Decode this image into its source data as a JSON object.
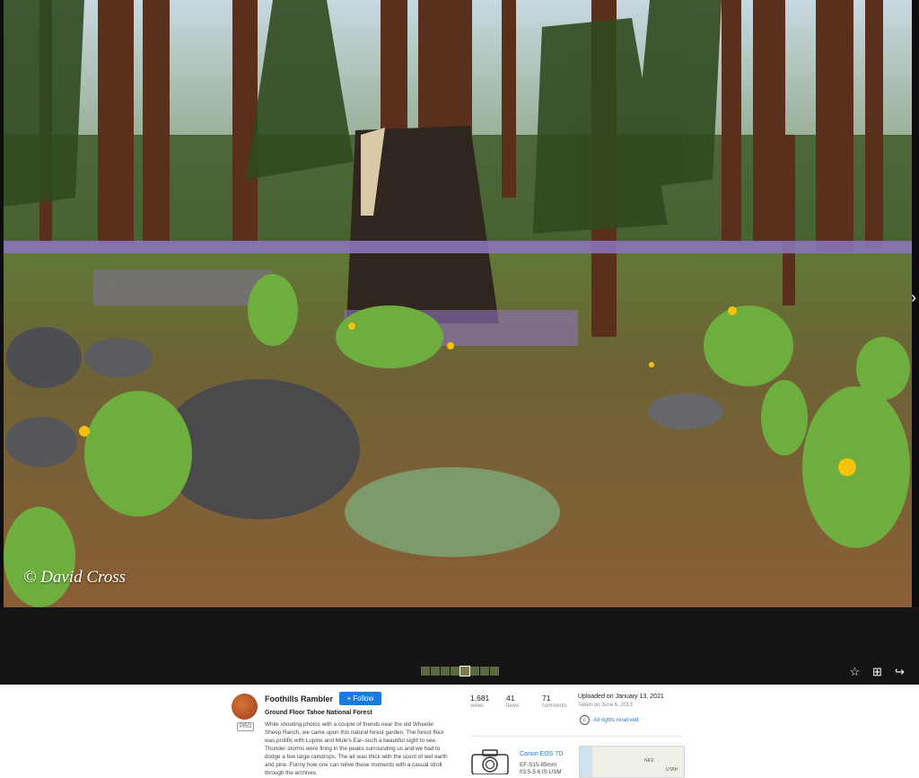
{
  "photo": {
    "watermark": "© David Cross"
  },
  "viewer_actions": {
    "icons": [
      "star-icon",
      "add-to-album-icon",
      "share-icon",
      "download-icon"
    ]
  },
  "author": {
    "name": "Foothills Rambler",
    "badge": "PRO",
    "follow_label": "Follow"
  },
  "photo_info": {
    "title": "Ground Floor Tahoe National Forest",
    "description": "While shooting photos with a couple of friends near the old Wheeler Sheep Ranch, we came upon this natural forest garden. The forest floor was prolific with Lupine and Mule's Ear–such a beautiful sight to see. Thunder storms were firing in the peaks surrounding us and we had to dodge a few large raindrops. The air was thick with the scent of wet earth and pine. Funny how one can relive these moments with a casual stroll through the archives."
  },
  "stats": [
    {
      "value": "1,681",
      "label": "views"
    },
    {
      "value": "41",
      "label": "faves"
    },
    {
      "value": "71",
      "label": "comments"
    }
  ],
  "upload": {
    "uploaded": "Uploaded on January 13, 2021",
    "taken": "Taken on June 6, 2013",
    "rights": "All rights reserved"
  },
  "camera": {
    "model": "Canon EOS 7D",
    "lens": "EF-S15-85mm",
    "aperture": "f/3.5-5.6 IS USM"
  },
  "map": {
    "label_nev": "NEV.",
    "label_utah": "UTAH"
  },
  "colors": {
    "accent": "#1c7bd8",
    "viewer_bg": "#141416"
  }
}
